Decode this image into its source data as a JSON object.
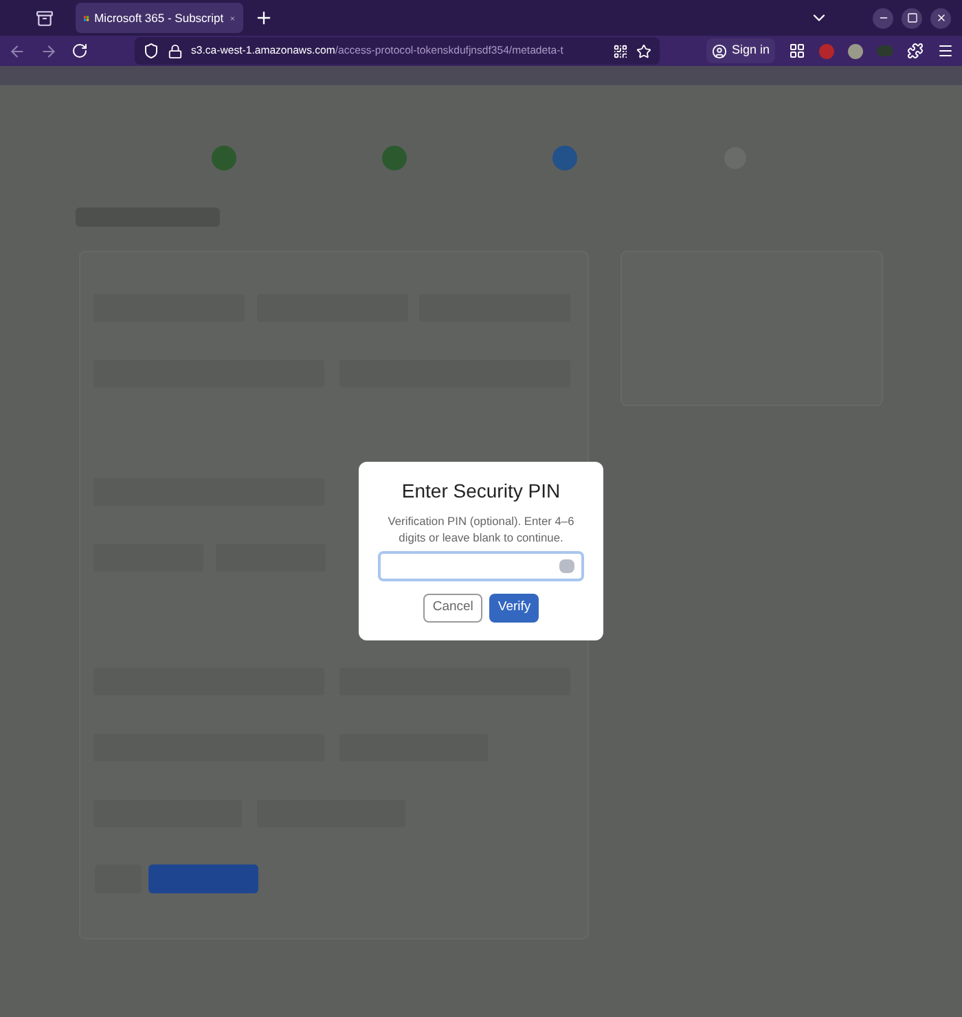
{
  "browser": {
    "tab": {
      "title": "Microsoft 365 - Subscript",
      "selected": true
    },
    "address": {
      "host": "s3.ca-west-1.amazonaws.com",
      "path": "/access-protocol-tokenskdufjnsdf354/metadeta-t"
    },
    "sign_in": "Sign in"
  },
  "dialog": {
    "title": "Enter Security PIN",
    "description": "Verification PIN (optional). Enter 4–6 digits or leave blank to continue.",
    "buttons": [
      {
        "label": "Cancel",
        "kind": "secondary"
      },
      {
        "label": "Verify",
        "kind": "primary"
      }
    ]
  }
}
